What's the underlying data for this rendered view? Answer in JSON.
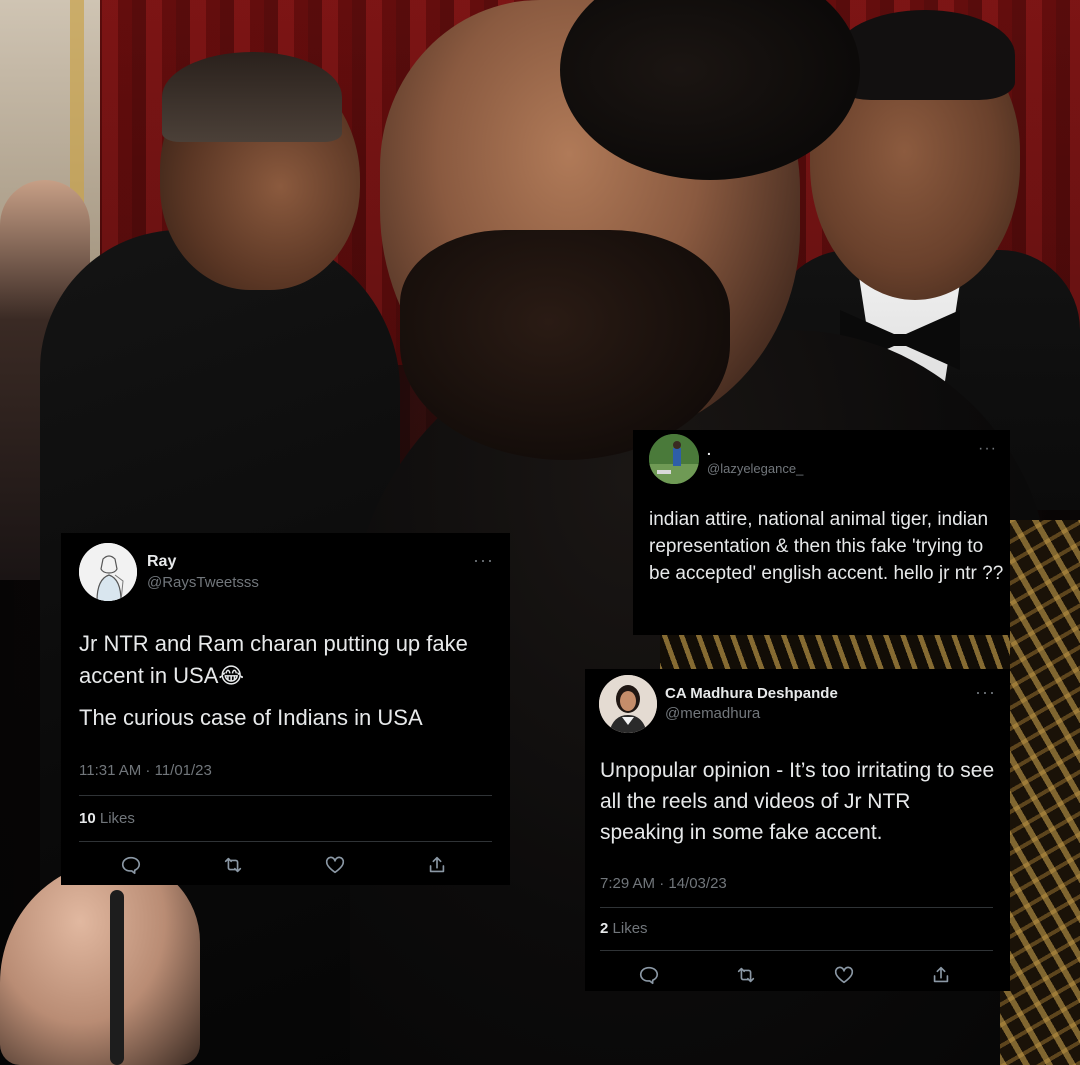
{
  "tweets": [
    {
      "name": "Ray",
      "handle": "@RaysTweetsss",
      "text_line1": "Jr NTR and Ram charan putting up fake accent in USA😂",
      "text_line2": "The curious case of Indians in USA",
      "timestamp": "11:31 AM · 11/01/23",
      "likes_count": "10",
      "likes_label": "Likes",
      "more_glyph": "···",
      "avatar_icon": "sketch-avatar-icon"
    },
    {
      "name": ".",
      "handle": "@lazyelegance_",
      "text": "indian attire, national animal tiger, indian representation & then this fake 'trying to be accepted' english accent. hello jr ntr ??",
      "more_glyph": "···",
      "avatar_icon": "cricket-photo-avatar"
    },
    {
      "name": "CA Madhura Deshpande",
      "handle": "@memadhura",
      "text": "Unpopular opinion - It’s too irritating to see all the reels and videos of Jr NTR speaking in some fake accent.",
      "timestamp": "7:29 AM · 14/03/23",
      "likes_count": "2",
      "likes_label": "Likes",
      "more_glyph": "···",
      "avatar_icon": "portrait-avatar"
    }
  ],
  "actions": [
    "reply-icon",
    "retweet-icon",
    "like-icon",
    "share-icon"
  ],
  "colors": {
    "card_bg": "#000000",
    "primary_text": "#e7e9ea",
    "secondary_text": "#71767b",
    "divider": "#2f3336"
  }
}
